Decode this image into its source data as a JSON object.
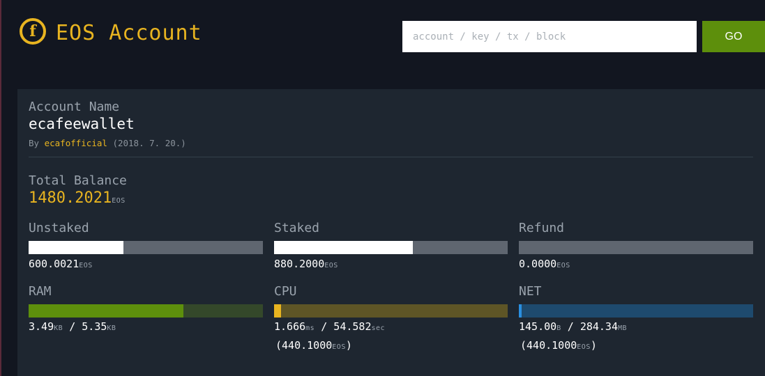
{
  "header": {
    "logo_letter": "f",
    "title": "EOS Account",
    "search_placeholder": "account / key / tx / block",
    "go_label": "GO"
  },
  "account": {
    "label": "Account Name",
    "name": "ecafeewallet",
    "by_prefix": "By",
    "creator": "ecafofficial",
    "created": "(2018. 7. 20.)"
  },
  "balance": {
    "label": "Total Balance",
    "amount": "1480.2021",
    "unit": "EOS"
  },
  "colors": {
    "accent": "#e8b420",
    "go_button": "#5d8f0c",
    "ram_fill": "#5d8f0c",
    "cpu_marker": "#e8b420",
    "net_marker": "#2a8fe0"
  },
  "stats": {
    "unstaked": {
      "label": "Unstaked",
      "amount": "600.0021",
      "unit": "EOS",
      "fraction": 0.405
    },
    "staked": {
      "label": "Staked",
      "amount": "880.2000",
      "unit": "EOS",
      "fraction": 0.595
    },
    "refund": {
      "label": "Refund",
      "amount": "0.0000",
      "unit": "EOS",
      "fraction": 0
    }
  },
  "resources": {
    "ram": {
      "label": "RAM",
      "used": "3.49",
      "used_unit": "KB",
      "sep": " / ",
      "total": "5.35",
      "total_unit": "KB",
      "fraction": 0.66
    },
    "cpu": {
      "label": "CPU",
      "used": "1.666",
      "used_unit": "ms",
      "sep": " / ",
      "total": "54.582",
      "total_unit": "sec",
      "fraction": 0.03,
      "stake_open": "(",
      "stake": "440.1000",
      "stake_unit": "EOS",
      "stake_close": ")"
    },
    "net": {
      "label": "NET",
      "used": "145.00",
      "used_unit": "B",
      "sep": " / ",
      "total": "284.34",
      "total_unit": "MB",
      "fraction": 0.0005,
      "stake_open": "(",
      "stake": "440.1000",
      "stake_unit": "EOS",
      "stake_close": ")"
    }
  }
}
